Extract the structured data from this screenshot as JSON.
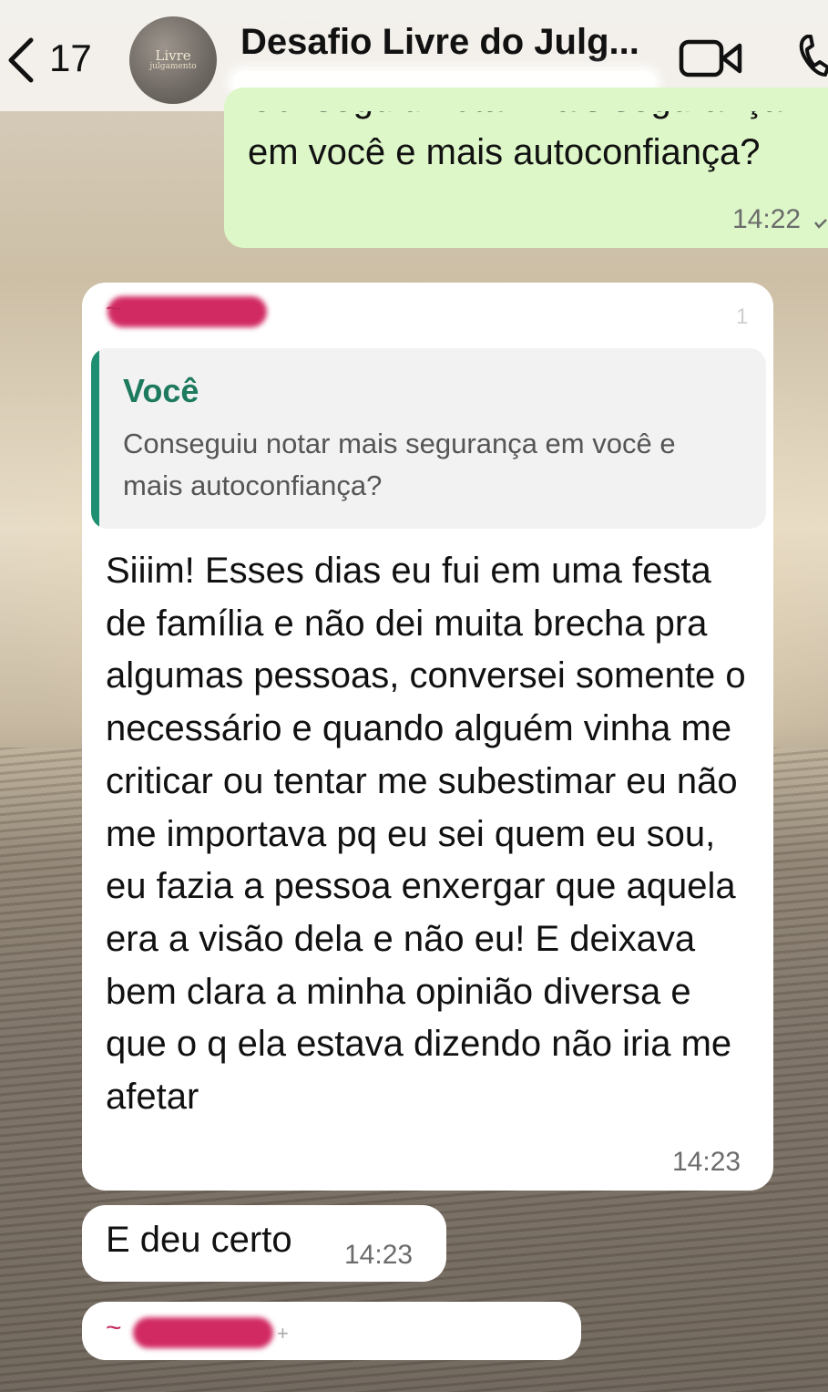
{
  "header": {
    "back_count": "17",
    "title": "Desafio Livre do Julg...",
    "avatar_text": "Livre",
    "avatar_sub": "julgamento"
  },
  "messages": {
    "outgoing": {
      "text": "Conseguiu notar mais segurança em você e mais autoconfiança?",
      "time": "14:22"
    },
    "incoming": {
      "reply_count": "1",
      "quote_author": "Você",
      "quote_text": "Conseguiu notar mais segurança em você e mais autoconfiança?",
      "text": "Siiim! Esses dias eu fui em uma festa de família e não dei muita brecha pra algumas pessoas, conversei somente o necessário e quando alguém vinha me criticar ou tentar me subestimar eu não me importava pq eu sei quem eu sou, eu fazia a pessoa enxergar que aquela era a visão dela e não eu! E deixava bem clara a minha opinião diversa e que o q ela estava dizendo não iria me afetar",
      "time": "14:23"
    },
    "incoming_short": {
      "text": "E deu certo",
      "time": "14:23"
    },
    "incoming_bottom": {
      "tilde": "~",
      "plus": "+"
    }
  },
  "sender_tilde": "~",
  "icons": {
    "back": "chevron-left-icon",
    "video": "video-camera-icon",
    "phone": "phone-icon",
    "read": "checkmark-icon"
  },
  "colors": {
    "outgoing_bubble": "#ddf7c8",
    "incoming_bubble": "#ffffff",
    "quote_bar": "#1e8f70",
    "redaction": "#d12a63"
  }
}
